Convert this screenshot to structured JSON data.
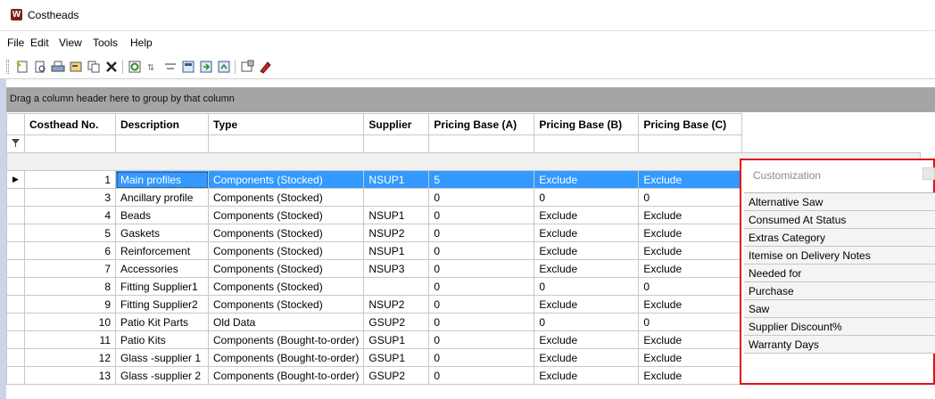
{
  "window": {
    "title": "Costheads"
  },
  "menu": [
    "File",
    "Edit",
    "View",
    "Tools",
    "Help"
  ],
  "toolbar_icons": [
    "new-icon",
    "preview-icon",
    "print-icon",
    "properties-icon",
    "copy-icon",
    "delete-icon",
    "refresh-icon",
    "sort-icon",
    "filter-icon",
    "export-icon",
    "import-icon",
    "save-icon",
    "settings-icon",
    "help-icon"
  ],
  "group_panel_text": "Drag a column header here to group by that column",
  "columns": [
    "Costhead No.",
    "Description",
    "Type",
    "Supplier",
    "Pricing Base (A)",
    "Pricing Base (B)",
    "Pricing Base (C)"
  ],
  "rows": [
    {
      "no": "1",
      "desc": "Main profiles",
      "type": "Components (Stocked)",
      "supplier": "NSUP1",
      "a": "5",
      "b": "Exclude",
      "c": "Exclude"
    },
    {
      "no": "3",
      "desc": "Ancillary profile",
      "type": "Components (Stocked)",
      "supplier": "",
      "a": "0",
      "b": "0",
      "c": "0"
    },
    {
      "no": "4",
      "desc": "Beads",
      "type": "Components (Stocked)",
      "supplier": "NSUP1",
      "a": "0",
      "b": "Exclude",
      "c": "Exclude"
    },
    {
      "no": "5",
      "desc": "Gaskets",
      "type": "Components (Stocked)",
      "supplier": "NSUP2",
      "a": "0",
      "b": "Exclude",
      "c": "Exclude"
    },
    {
      "no": "6",
      "desc": "Reinforcement",
      "type": "Components (Stocked)",
      "supplier": "NSUP1",
      "a": "0",
      "b": "Exclude",
      "c": "Exclude"
    },
    {
      "no": "7",
      "desc": "Accessories",
      "type": "Components (Stocked)",
      "supplier": "NSUP3",
      "a": "0",
      "b": "Exclude",
      "c": "Exclude"
    },
    {
      "no": "8",
      "desc": "Fitting Supplier1",
      "type": "Components (Stocked)",
      "supplier": "",
      "a": "0",
      "b": "0",
      "c": "0"
    },
    {
      "no": "9",
      "desc": "Fitting Supplier2",
      "type": "Components (Stocked)",
      "supplier": "NSUP2",
      "a": "0",
      "b": "Exclude",
      "c": "Exclude"
    },
    {
      "no": "10",
      "desc": "Patio Kit Parts",
      "type": "Old Data",
      "supplier": "GSUP2",
      "a": "0",
      "b": "0",
      "c": "0"
    },
    {
      "no": "11",
      "desc": "Patio Kits",
      "type": "Components (Bought-to-order)",
      "supplier": "GSUP1",
      "a": "0",
      "b": "Exclude",
      "c": "Exclude"
    },
    {
      "no": "12",
      "desc": "Glass -supplier 1",
      "type": "Components (Bought-to-order)",
      "supplier": "GSUP1",
      "a": "0",
      "b": "Exclude",
      "c": "Exclude"
    },
    {
      "no": "13",
      "desc": "Glass -supplier 2",
      "type": "Components (Bought-to-order)",
      "supplier": "GSUP2",
      "a": "0",
      "b": "Exclude",
      "c": "Exclude"
    }
  ],
  "customization": {
    "title": "Customization",
    "items": [
      "Alternative Saw",
      "Consumed At Status",
      "Extras Category",
      "Itemise on Delivery Notes",
      "Needed for",
      "Purchase",
      "Saw",
      "Supplier Discount%",
      "Warranty Days"
    ]
  },
  "colors": {
    "selection": "#3399ff",
    "highlight_border": "#e0131b",
    "group_panel": "#a5a5a5"
  }
}
